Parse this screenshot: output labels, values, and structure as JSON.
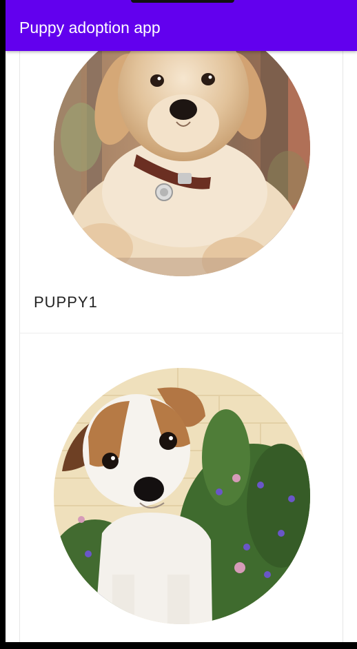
{
  "app_bar": {
    "title": "Puppy adoption app",
    "color": "#6200ee"
  },
  "puppies": [
    {
      "name": "PUPPY1",
      "image": "golden-retriever-puppy-photo"
    },
    {
      "name": "",
      "image": "jack-russell-puppy-photo"
    }
  ]
}
